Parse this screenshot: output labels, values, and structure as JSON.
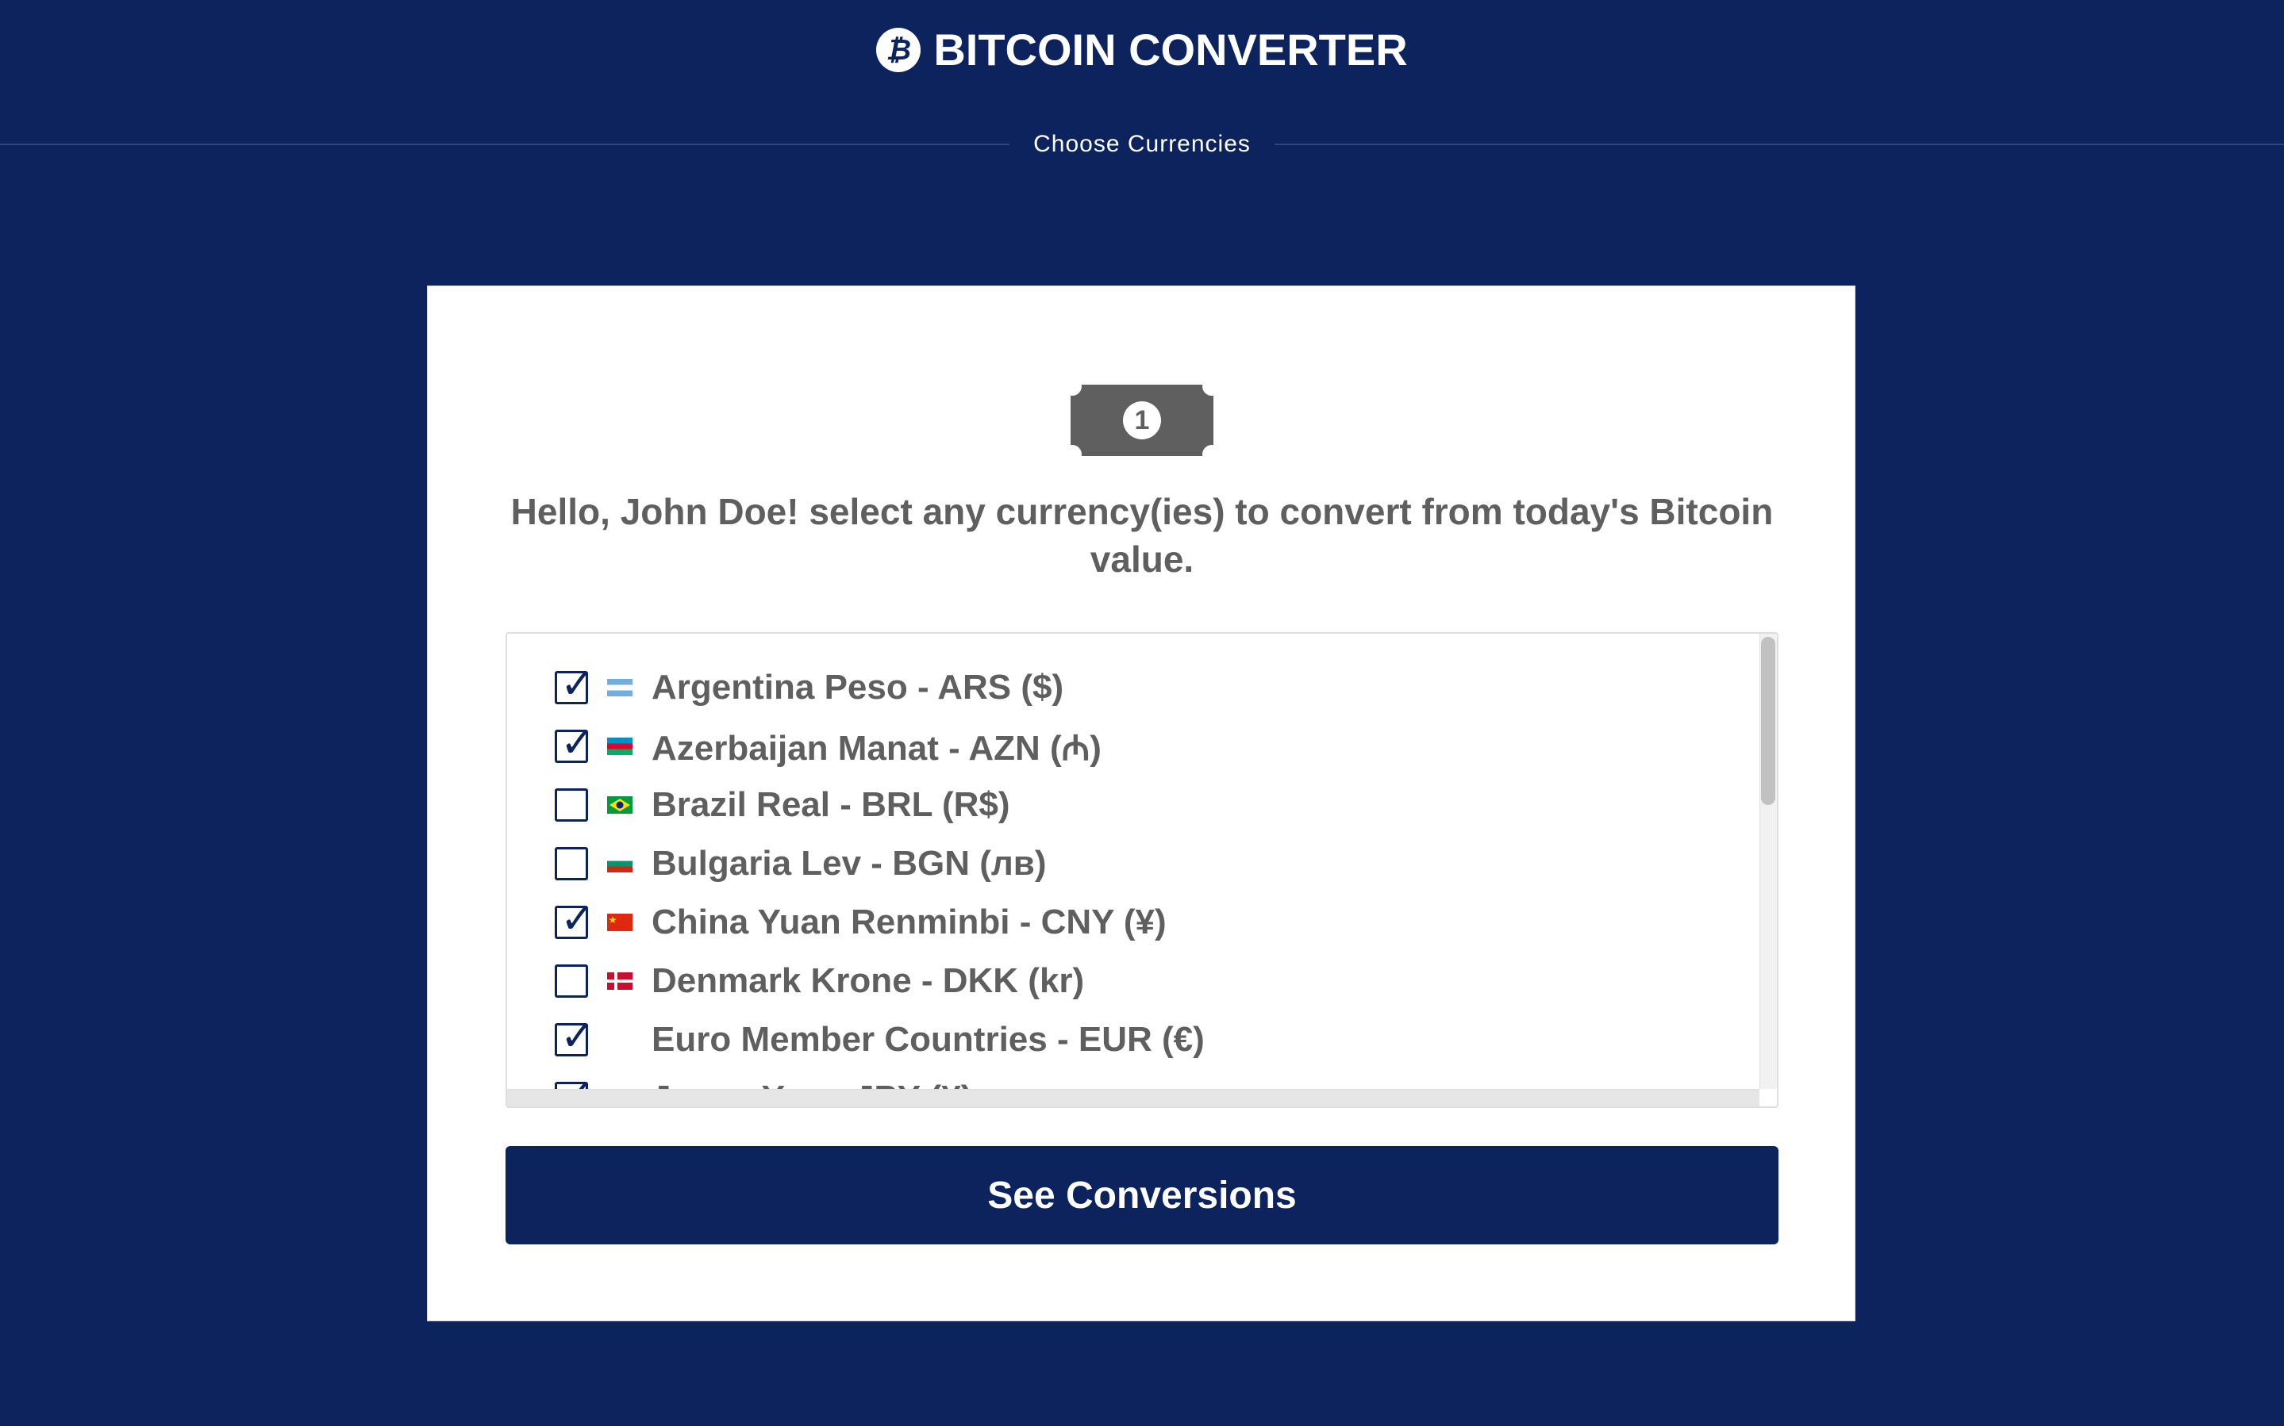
{
  "header": {
    "title": "BITCOIN CONVERTER",
    "logo_glyph": "₿",
    "subtitle": "Choose Currencies"
  },
  "card": {
    "coin_glyph": "1",
    "greeting": "Hello, John Doe! select any currency(ies) to convert from today's Bitcoin value."
  },
  "currencies": [
    {
      "label": "Argentina Peso - ARS ($)",
      "checked": true,
      "flag": "flag-argentina-icon"
    },
    {
      "label": "Azerbaijan Manat - AZN (₼)",
      "checked": true,
      "flag": "flag-azerbaijan-icon"
    },
    {
      "label": "Brazil Real - BRL (R$)",
      "checked": false,
      "flag": "flag-brazil-icon"
    },
    {
      "label": "Bulgaria Lev - BGN (лв)",
      "checked": false,
      "flag": "flag-bulgaria-icon"
    },
    {
      "label": "China Yuan Renminbi - CNY (¥)",
      "checked": true,
      "flag": "flag-china-icon"
    },
    {
      "label": "Denmark Krone - DKK (kr)",
      "checked": false,
      "flag": "flag-denmark-icon"
    },
    {
      "label": "Euro Member Countries - EUR (€)",
      "checked": true,
      "flag": ""
    },
    {
      "label": "Japan Yen - JPY (¥)",
      "checked": true,
      "flag": ""
    }
  ],
  "button": {
    "label": "See Conversions"
  },
  "colors": {
    "background": "#0c235e",
    "text_gray": "#5f5f5f",
    "card": "#ffffff"
  }
}
